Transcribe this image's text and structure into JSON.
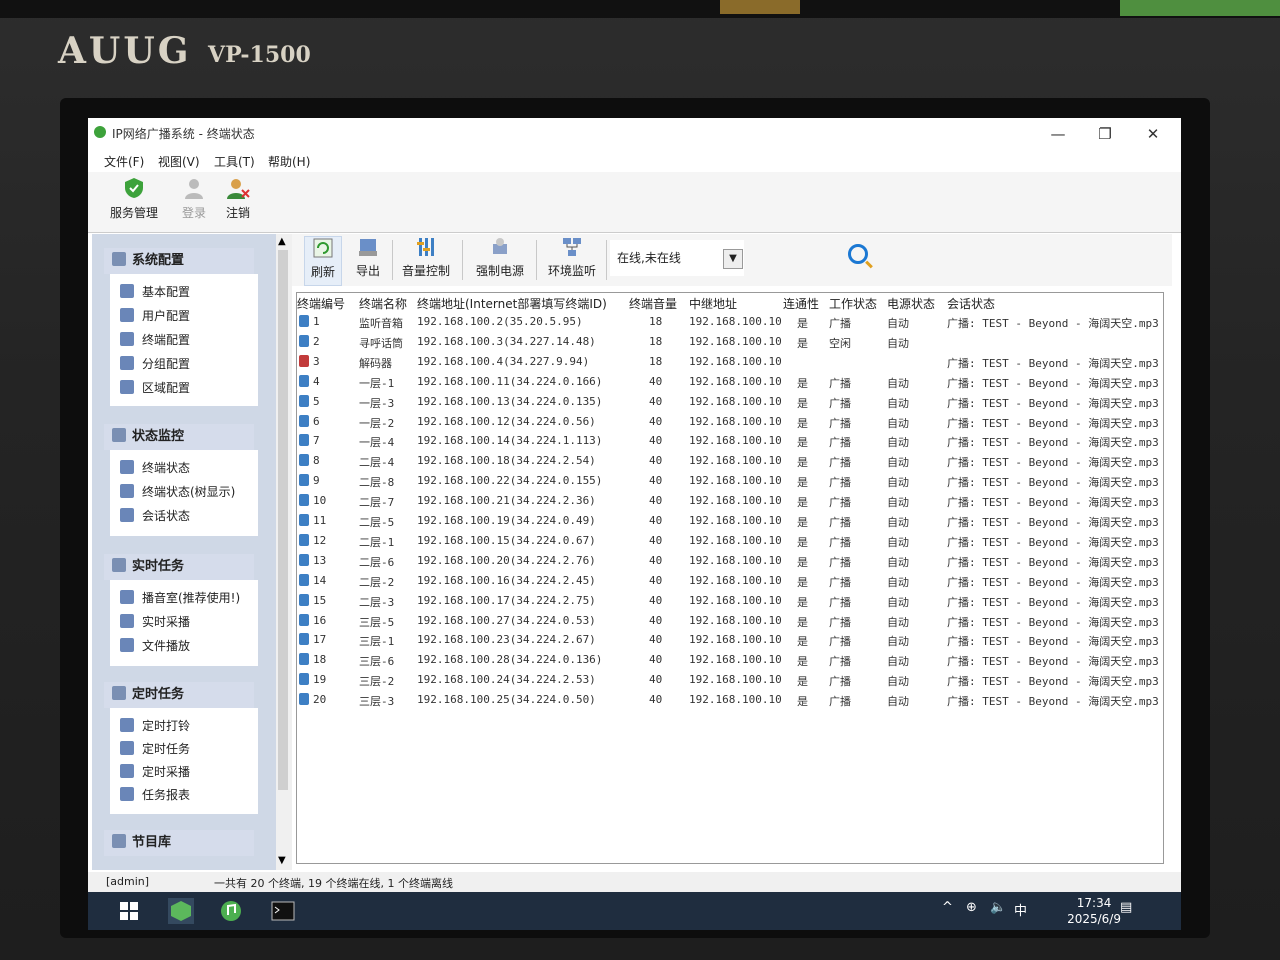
{
  "device": {
    "brand": "AUUG",
    "model": "VP-1500"
  },
  "window": {
    "title": "IP网络广播系统 - 终端状态",
    "minimize": "—",
    "maximize": "❐",
    "close": "✕"
  },
  "menubar": {
    "items": [
      "文件(F)",
      "视图(V)",
      "工具(T)",
      "帮助(H)"
    ]
  },
  "toolbar": {
    "service": "服务管理",
    "login": "登录",
    "logout": "注销"
  },
  "sidebar": {
    "system_config": {
      "title": "系统配置",
      "items": [
        "基本配置",
        "用户配置",
        "终端配置",
        "分组配置",
        "区域配置"
      ]
    },
    "status_monitor": {
      "title": "状态监控",
      "items": [
        "终端状态",
        "终端状态(树显示)",
        "会话状态"
      ]
    },
    "realtime_tasks": {
      "title": "实时任务",
      "items": [
        "播音室(推荐使用!)",
        "实时采播",
        "文件播放"
      ]
    },
    "scheduled_tasks": {
      "title": "定时任务",
      "items": [
        "定时打铃",
        "定时任务",
        "定时采播",
        "任务报表"
      ]
    },
    "program_library": {
      "title": "节目库"
    }
  },
  "panel_toolbar": {
    "refresh": "刷新",
    "export": "导出",
    "volume": "音量控制",
    "power": "强制电源",
    "env": "环境监听",
    "filter_value": "在线,未在线"
  },
  "table": {
    "headers": [
      "终端编号",
      "终端名称",
      "终端地址(Internet部署填写终端ID)",
      "终端音量",
      "中继地址",
      "连通性",
      "工作状态",
      "电源状态",
      "会话状态"
    ],
    "rows": [
      [
        "1",
        "监听音箱",
        "192.168.100.2(35.20.5.95)",
        "18",
        "192.168.100.10",
        "是",
        "广播",
        "自动",
        "广播: TEST - Beyond - 海阔天空.mp3"
      ],
      [
        "2",
        "寻呼话筒",
        "192.168.100.3(34.227.14.48)",
        "18",
        "192.168.100.10",
        "是",
        "空闲",
        "自动",
        ""
      ],
      [
        "3",
        "解码器",
        "192.168.100.4(34.227.9.94)",
        "18",
        "192.168.100.10",
        "",
        "",
        "",
        "广播: TEST - Beyond - 海阔天空.mp3"
      ],
      [
        "4",
        "一层-1",
        "192.168.100.11(34.224.0.166)",
        "40",
        "192.168.100.10",
        "是",
        "广播",
        "自动",
        "广播: TEST - Beyond - 海阔天空.mp3"
      ],
      [
        "5",
        "一层-3",
        "192.168.100.13(34.224.0.135)",
        "40",
        "192.168.100.10",
        "是",
        "广播",
        "自动",
        "广播: TEST - Beyond - 海阔天空.mp3"
      ],
      [
        "6",
        "一层-2",
        "192.168.100.12(34.224.0.56)",
        "40",
        "192.168.100.10",
        "是",
        "广播",
        "自动",
        "广播: TEST - Beyond - 海阔天空.mp3"
      ],
      [
        "7",
        "一层-4",
        "192.168.100.14(34.224.1.113)",
        "40",
        "192.168.100.10",
        "是",
        "广播",
        "自动",
        "广播: TEST - Beyond - 海阔天空.mp3"
      ],
      [
        "8",
        "二层-4",
        "192.168.100.18(34.224.2.54)",
        "40",
        "192.168.100.10",
        "是",
        "广播",
        "自动",
        "广播: TEST - Beyond - 海阔天空.mp3"
      ],
      [
        "9",
        "二层-8",
        "192.168.100.22(34.224.0.155)",
        "40",
        "192.168.100.10",
        "是",
        "广播",
        "自动",
        "广播: TEST - Beyond - 海阔天空.mp3"
      ],
      [
        "10",
        "二层-7",
        "192.168.100.21(34.224.2.36)",
        "40",
        "192.168.100.10",
        "是",
        "广播",
        "自动",
        "广播: TEST - Beyond - 海阔天空.mp3"
      ],
      [
        "11",
        "二层-5",
        "192.168.100.19(34.224.0.49)",
        "40",
        "192.168.100.10",
        "是",
        "广播",
        "自动",
        "广播: TEST - Beyond - 海阔天空.mp3"
      ],
      [
        "12",
        "二层-1",
        "192.168.100.15(34.224.0.67)",
        "40",
        "192.168.100.10",
        "是",
        "广播",
        "自动",
        "广播: TEST - Beyond - 海阔天空.mp3"
      ],
      [
        "13",
        "二层-6",
        "192.168.100.20(34.224.2.76)",
        "40",
        "192.168.100.10",
        "是",
        "广播",
        "自动",
        "广播: TEST - Beyond - 海阔天空.mp3"
      ],
      [
        "14",
        "二层-2",
        "192.168.100.16(34.224.2.45)",
        "40",
        "192.168.100.10",
        "是",
        "广播",
        "自动",
        "广播: TEST - Beyond - 海阔天空.mp3"
      ],
      [
        "15",
        "二层-3",
        "192.168.100.17(34.224.2.75)",
        "40",
        "192.168.100.10",
        "是",
        "广播",
        "自动",
        "广播: TEST - Beyond - 海阔天空.mp3"
      ],
      [
        "16",
        "三层-5",
        "192.168.100.27(34.224.0.53)",
        "40",
        "192.168.100.10",
        "是",
        "广播",
        "自动",
        "广播: TEST - Beyond - 海阔天空.mp3"
      ],
      [
        "17",
        "三层-1",
        "192.168.100.23(34.224.2.67)",
        "40",
        "192.168.100.10",
        "是",
        "广播",
        "自动",
        "广播: TEST - Beyond - 海阔天空.mp3"
      ],
      [
        "18",
        "三层-6",
        "192.168.100.28(34.224.0.136)",
        "40",
        "192.168.100.10",
        "是",
        "广播",
        "自动",
        "广播: TEST - Beyond - 海阔天空.mp3"
      ],
      [
        "19",
        "三层-2",
        "192.168.100.24(34.224.2.53)",
        "40",
        "192.168.100.10",
        "是",
        "广播",
        "自动",
        "广播: TEST - Beyond - 海阔天空.mp3"
      ],
      [
        "20",
        "三层-3",
        "192.168.100.25(34.224.0.50)",
        "40",
        "192.168.100.10",
        "是",
        "广播",
        "自动",
        "广播: TEST - Beyond - 海阔天空.mp3"
      ]
    ]
  },
  "statusbar": {
    "user": "[admin]",
    "message": "一共有 20 个终端, 19 个终端在线, 1 个终端离线"
  },
  "taskbar": {
    "time": "17:34",
    "date": "2025/6/9",
    "ime": "中",
    "caret": "^"
  },
  "icons": {
    "window": "app-icon",
    "search": "search-icon",
    "terminal": "speaker-icon"
  },
  "colors": {
    "taskbar": "#1f2d3f",
    "sidebar": "#cfd8e6",
    "offline_icon": "#c23b3b",
    "online_icon": "#3d7fc4"
  }
}
